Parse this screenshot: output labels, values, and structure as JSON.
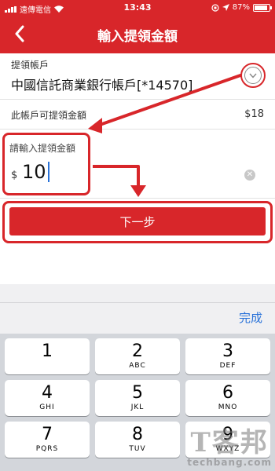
{
  "status_bar": {
    "carrier": "遠傳電信",
    "time": "13:43",
    "battery_text": "87%",
    "battery_level": 0.87
  },
  "nav": {
    "title": "輸入提領金額",
    "back_icon": "chevron-left-icon"
  },
  "account": {
    "label": "提領帳戶",
    "value": "中國信託商業銀行帳戶[*14570]",
    "dropdown_icon": "chevron-down-circle-icon"
  },
  "available": {
    "label": "此帳戶可提領金額",
    "value": "$18"
  },
  "amount": {
    "label": "請輸入提領金額",
    "currency": "$",
    "value": "10",
    "clear_icon": "clear-icon"
  },
  "next_button": {
    "label": "下一步"
  },
  "keyboard": {
    "done_label": "完成",
    "keys": [
      {
        "num": "1",
        "letters": ""
      },
      {
        "num": "2",
        "letters": "ABC"
      },
      {
        "num": "3",
        "letters": "DEF"
      },
      {
        "num": "4",
        "letters": "GHI"
      },
      {
        "num": "5",
        "letters": "JKL"
      },
      {
        "num": "6",
        "letters": "MNO"
      },
      {
        "num": "7",
        "letters": "PQRS"
      },
      {
        "num": "8",
        "letters": "TUV"
      },
      {
        "num": "9",
        "letters": "WXYZ"
      }
    ]
  },
  "watermark": {
    "brand": "T客邦",
    "url": "techbang.com"
  },
  "colors": {
    "brand_red": "#d8262a",
    "accent_blue": "#2a73d9",
    "annotation_red": "#d8262a"
  }
}
